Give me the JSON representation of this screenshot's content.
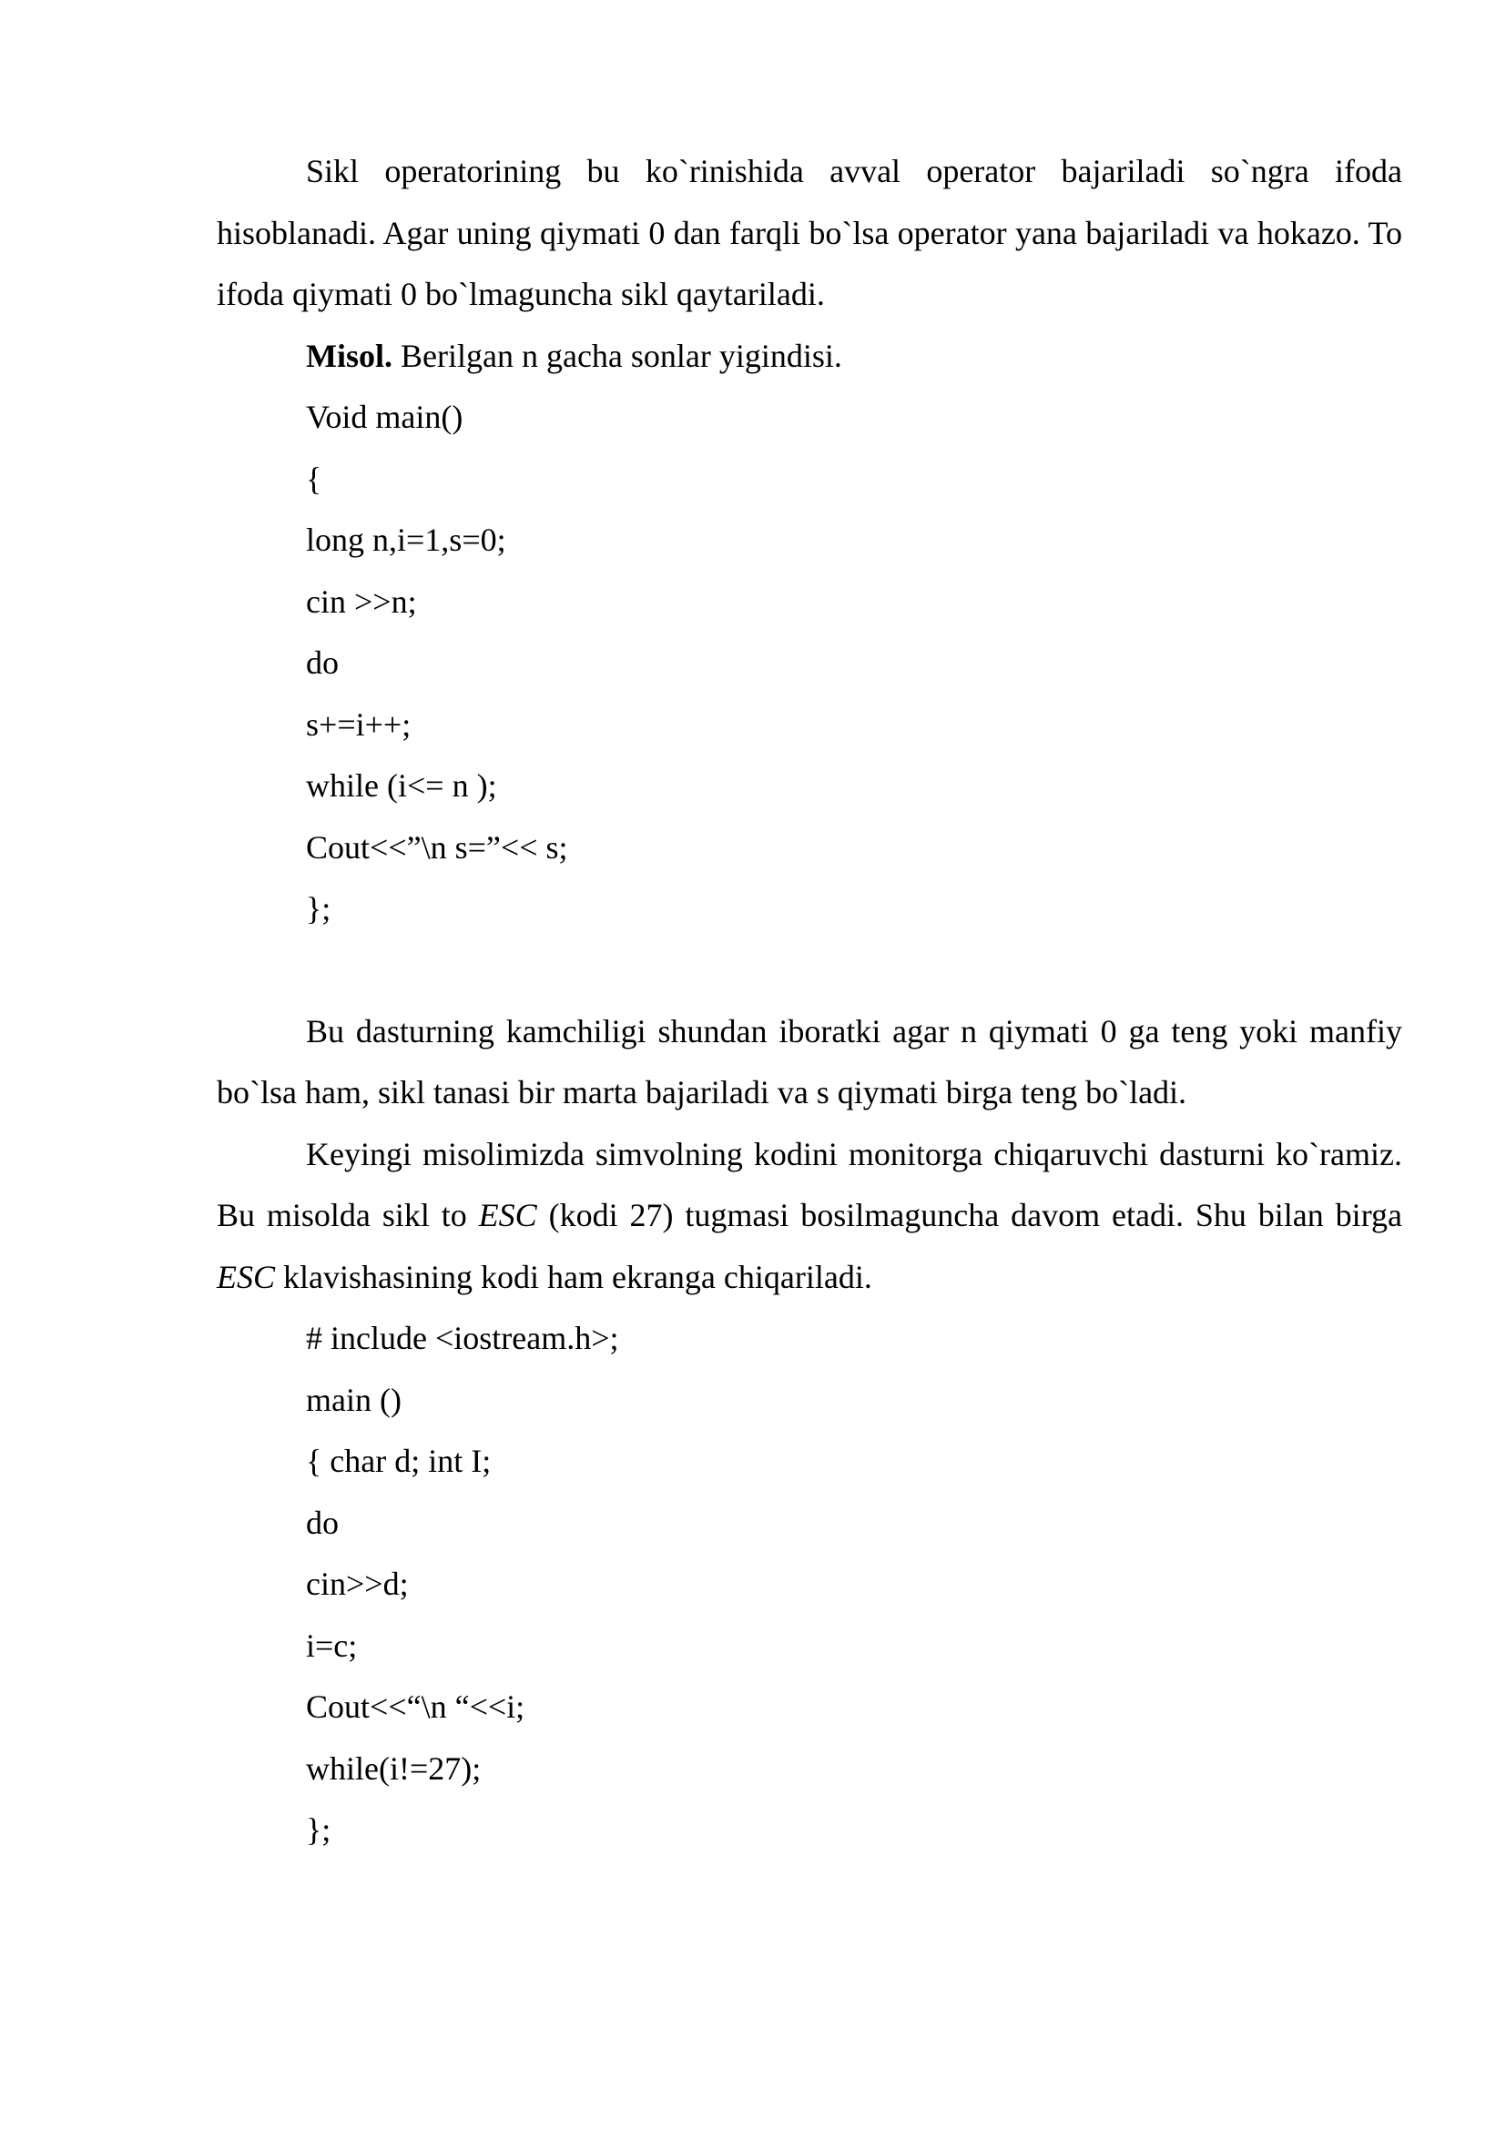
{
  "section1": {
    "para1": "Sikl operatorining bu ko`rinishida avval operator bajariladi so`ngra ifoda hisoblanadi. Agar uning qiymati 0 dan farqli bo`lsa operator yana bajariladi va hokazo. To ifoda qiymati 0 bo`lmaguncha sikl qaytariladi.",
    "example_label": "Misol.",
    "example_text": " Berilgan n gacha sonlar yigindisi."
  },
  "code1": [
    "Void main()",
    "{",
    "long n,i=1,s=0;",
    "cin >>n;",
    "do",
    "s+=i++;",
    "while (i<= n );",
    "Cout<<”\\n s=”<< s;",
    "};"
  ],
  "section2": {
    "para2": "Bu dasturning kamchiligi shundan iboratki agar n qiymati 0 ga teng yoki manfiy bo`lsa ham, sikl tanasi bir marta bajariladi va s qiymati birga teng bo`ladi.",
    "para3_a": "Keyingi misolimizda simvolning kodini monitorga chiqaruvchi dasturni ko`ramiz. Bu misolda sikl to ",
    "para3_esc1": "ESC",
    "para3_b": " (kodi 27) tugmasi bosilmaguncha davom etadi. Shu bilan birga ",
    "para3_esc2": "ESC",
    "para3_c": " klavishasining kodi ham ekranga chiqariladi."
  },
  "code2": [
    "# include <iostream.h>;",
    "main ()",
    "{ char d; int I;",
    "do",
    "cin>>d;",
    "i=c;",
    "Cout<<“\\n “<<i;",
    "while(i!=27);",
    "};"
  ]
}
